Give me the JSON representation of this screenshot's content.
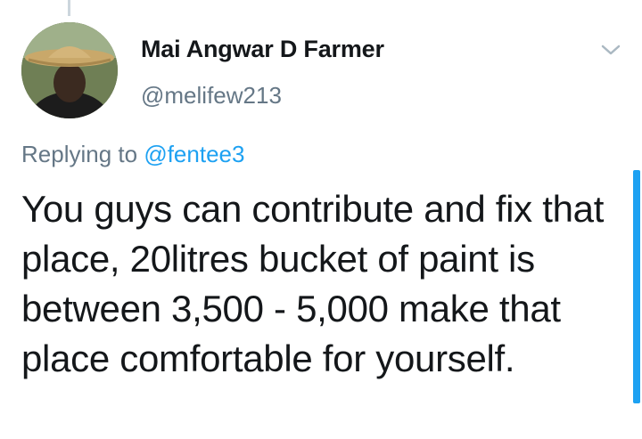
{
  "tweet": {
    "author": {
      "display_name": "Mai Angwar D Farmer",
      "handle": "@melifew213"
    },
    "reply": {
      "prefix": "Replying to",
      "mention": "@fentee3"
    },
    "text": "You guys can contribute and fix that place, 20litres bucket of paint is between 3,500 - 5,000 make that place comfortable for yourself.",
    "menu_icon": "chevron-down-icon"
  },
  "colors": {
    "text_primary": "#14171a",
    "text_secondary": "#657786",
    "link": "#1da1f2",
    "thread_line": "#ccd6dd"
  }
}
